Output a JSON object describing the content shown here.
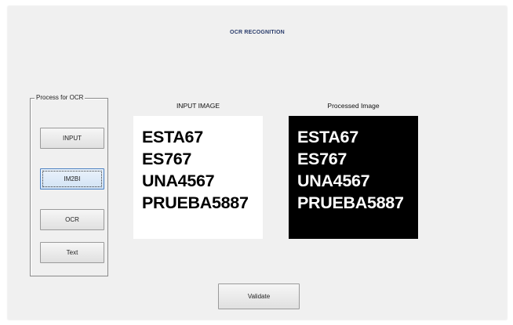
{
  "window": {
    "title": "OCR RECOGNITION"
  },
  "panel": {
    "legend": "Process for OCR",
    "buttons": {
      "input": "INPUT",
      "im2bi": "IM2BI",
      "ocr": "OCR",
      "text": "Text"
    }
  },
  "input_image": {
    "caption": "INPUT IMAGE",
    "lines": [
      "ESTA67",
      "ES767",
      "UNA4567",
      "PRUEBA5887"
    ]
  },
  "processed_image": {
    "caption": "Processed Image",
    "lines": [
      "ESTA67",
      "ES767",
      "UNA4567",
      "PRUEBA5887"
    ]
  },
  "validate_label": "Validate",
  "colors": {
    "background": "#f0f0f0",
    "title": "#2a3c6b",
    "focus_accent": "#4a7fc1",
    "processed_bg": "#000000",
    "input_bg": "#ffffff"
  }
}
